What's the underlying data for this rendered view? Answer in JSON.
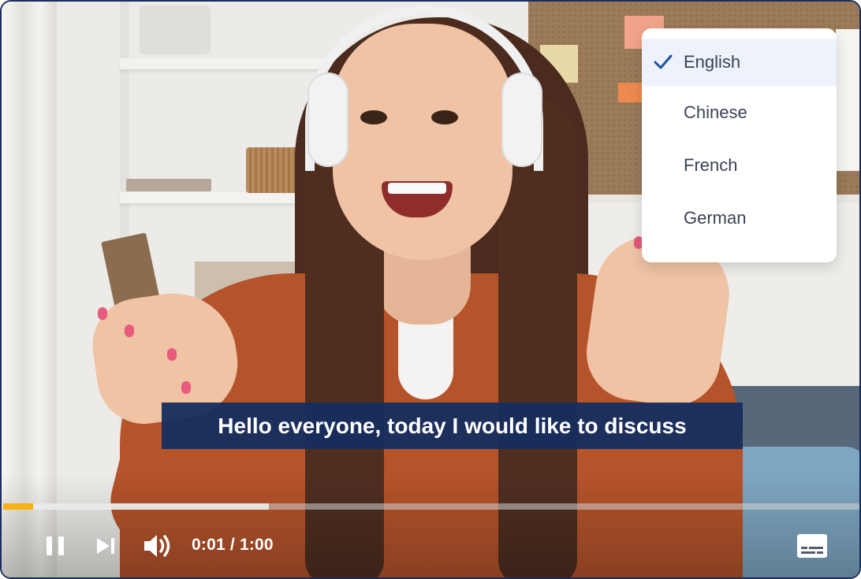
{
  "subtitle_menu": {
    "items": [
      {
        "label": "English",
        "selected": true
      },
      {
        "label": "Chinese",
        "selected": false
      },
      {
        "label": "French",
        "selected": false
      },
      {
        "label": "German",
        "selected": false
      }
    ],
    "check_icon": "check-icon"
  },
  "caption": {
    "text": "Hello everyone, today I would like to discuss"
  },
  "player": {
    "current_time": "0:01",
    "duration": "1:00",
    "time_separator": "/",
    "played_fraction": 0.035,
    "buffered_fraction": 0.31,
    "accent_color": "#f5b21a",
    "caption_bg_color": "#152d5e",
    "icons": {
      "pause": "pause-icon",
      "next": "skip-next-icon",
      "volume": "volume-icon",
      "subtitles": "subtitles-icon"
    }
  }
}
